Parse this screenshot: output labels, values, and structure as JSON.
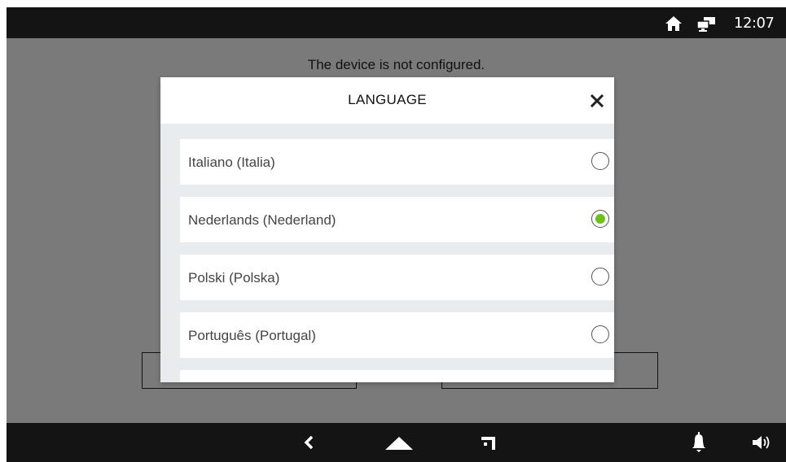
{
  "status_bar": {
    "clock": "12:07",
    "icons": [
      "home-icon",
      "network-icon"
    ]
  },
  "notice": "The device is not configured.",
  "dialog": {
    "title": "LANGUAGE",
    "close_icon": "close-icon",
    "items": [
      {
        "label": "Italiano (Italia)",
        "selected": false
      },
      {
        "label": "Nederlands (Nederland)",
        "selected": true
      },
      {
        "label": "Polski (Polska)",
        "selected": false
      },
      {
        "label": "Português (Portugal)",
        "selected": false
      },
      {
        "label": "",
        "selected": false
      }
    ]
  },
  "nav_bar": {
    "icons": [
      "back-icon",
      "home-icon",
      "recents-icon",
      "bell-icon",
      "volume-icon"
    ]
  },
  "colors": {
    "accent": "#6cc21a",
    "overlay": "#7a7a7a",
    "bar": "#141414"
  }
}
